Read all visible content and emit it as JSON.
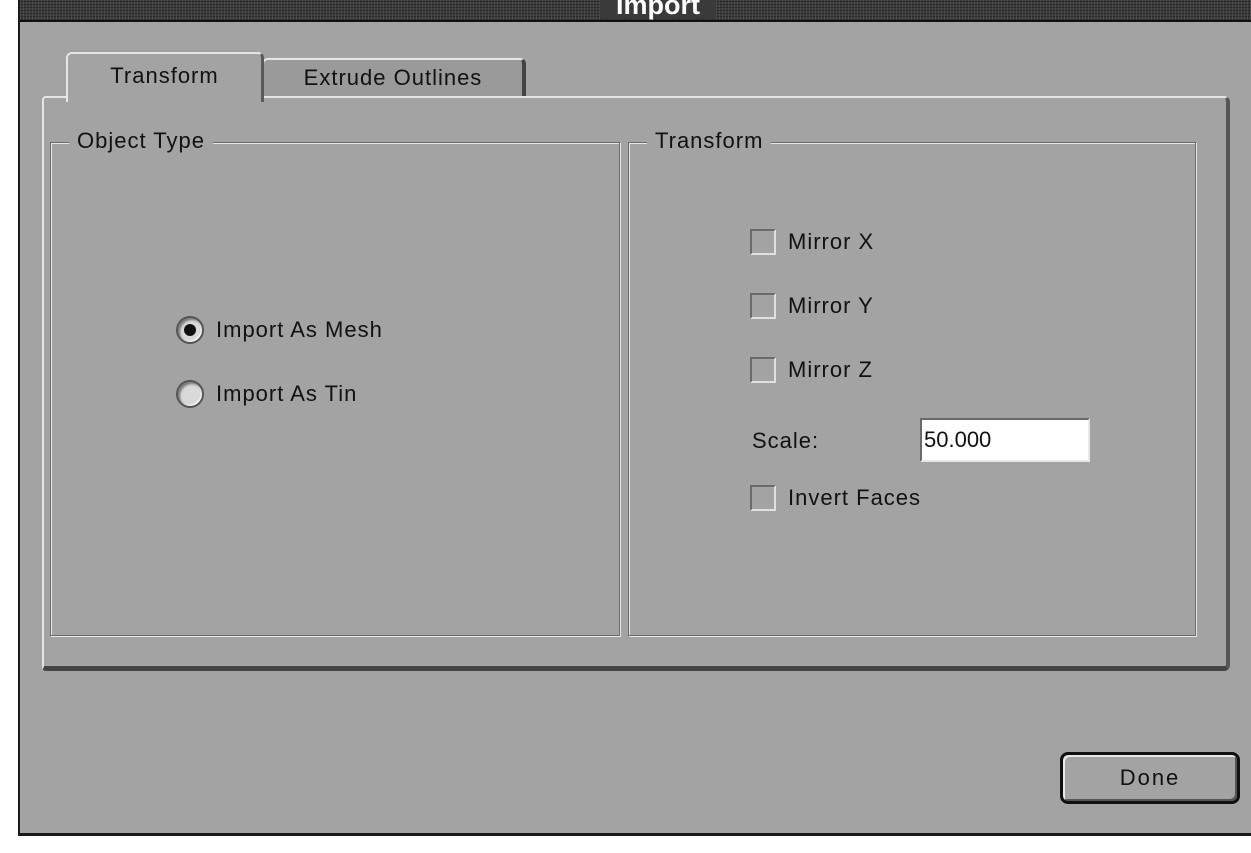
{
  "window": {
    "title": "Import"
  },
  "tabs": [
    {
      "label": "Transform",
      "active": true
    },
    {
      "label": "Extrude Outlines",
      "active": false
    }
  ],
  "object_type": {
    "legend": "Object Type",
    "options": [
      {
        "label": "Import As Mesh",
        "checked": true
      },
      {
        "label": "Import As Tin",
        "checked": false
      }
    ]
  },
  "transform": {
    "legend": "Transform",
    "mirror_x": {
      "label": "Mirror X",
      "checked": false
    },
    "mirror_y": {
      "label": "Mirror Y",
      "checked": false
    },
    "mirror_z": {
      "label": "Mirror Z",
      "checked": false
    },
    "scale_label": "Scale:",
    "scale_value": "50.000",
    "invert_faces": {
      "label": "Invert Faces",
      "checked": false
    }
  },
  "footer": {
    "done_label": "Done"
  }
}
